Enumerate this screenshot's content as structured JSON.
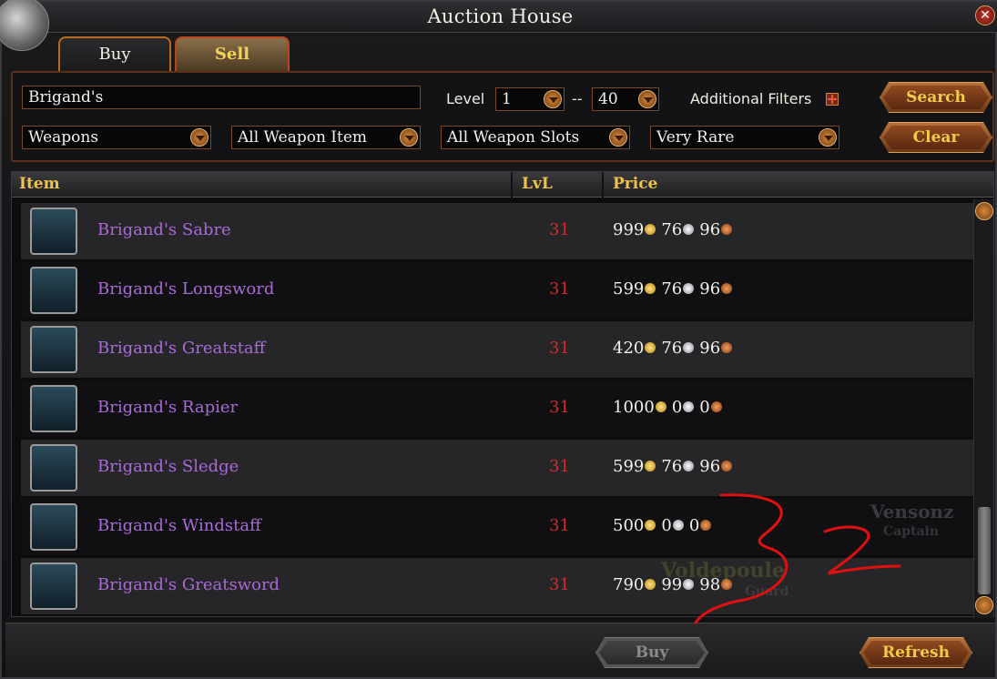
{
  "window": {
    "title": "Auction House"
  },
  "tabs": [
    {
      "label": "Buy",
      "active": true
    },
    {
      "label": "Sell",
      "active": false
    }
  ],
  "filters": {
    "search_value": "Brigand's",
    "level_label": "Level",
    "level_min": "1",
    "level_separator": "--",
    "level_max": "40",
    "additional_filters_label": "Additional Filters",
    "category": "Weapons",
    "item_type": "All Weapon Item",
    "slots": "All Weapon Slots",
    "rarity": "Very Rare",
    "search_button": "Search",
    "clear_button": "Clear"
  },
  "table": {
    "headers": {
      "item": "Item",
      "level": "LvL",
      "price": "Price"
    },
    "rows": [
      {
        "name": "Brigand's Sabre",
        "level": "31",
        "gold": "999",
        "silver": "76",
        "copper": "96"
      },
      {
        "name": "Brigand's Longsword",
        "level": "31",
        "gold": "599",
        "silver": "76",
        "copper": "96"
      },
      {
        "name": "Brigand's Greatstaff",
        "level": "31",
        "gold": "420",
        "silver": "76",
        "copper": "96"
      },
      {
        "name": "Brigand's Rapier",
        "level": "31",
        "gold": "1000",
        "silver": "0",
        "copper": "0"
      },
      {
        "name": "Brigand's Sledge",
        "level": "31",
        "gold": "599",
        "silver": "76",
        "copper": "96"
      },
      {
        "name": "Brigand's Windstaff",
        "level": "31",
        "gold": "500",
        "silver": "0",
        "copper": "0"
      },
      {
        "name": "Brigand's Greatsword",
        "level": "31",
        "gold": "790",
        "silver": "99",
        "copper": "98"
      }
    ]
  },
  "background_text": {
    "player_name": "Vensonz",
    "player_title": "Captain",
    "npc_name": "Voldepoule",
    "npc_subtitle": "Guard"
  },
  "footer": {
    "buy_button": "Buy",
    "refresh_button": "Refresh"
  },
  "colors": {
    "item_name": "#a96ad8",
    "level": "#d42a2a",
    "header_text": "#f0c24a",
    "button_text": "#f2c94a",
    "annotation": "#e01010"
  },
  "annotation": {
    "handwritten_text": "32"
  }
}
